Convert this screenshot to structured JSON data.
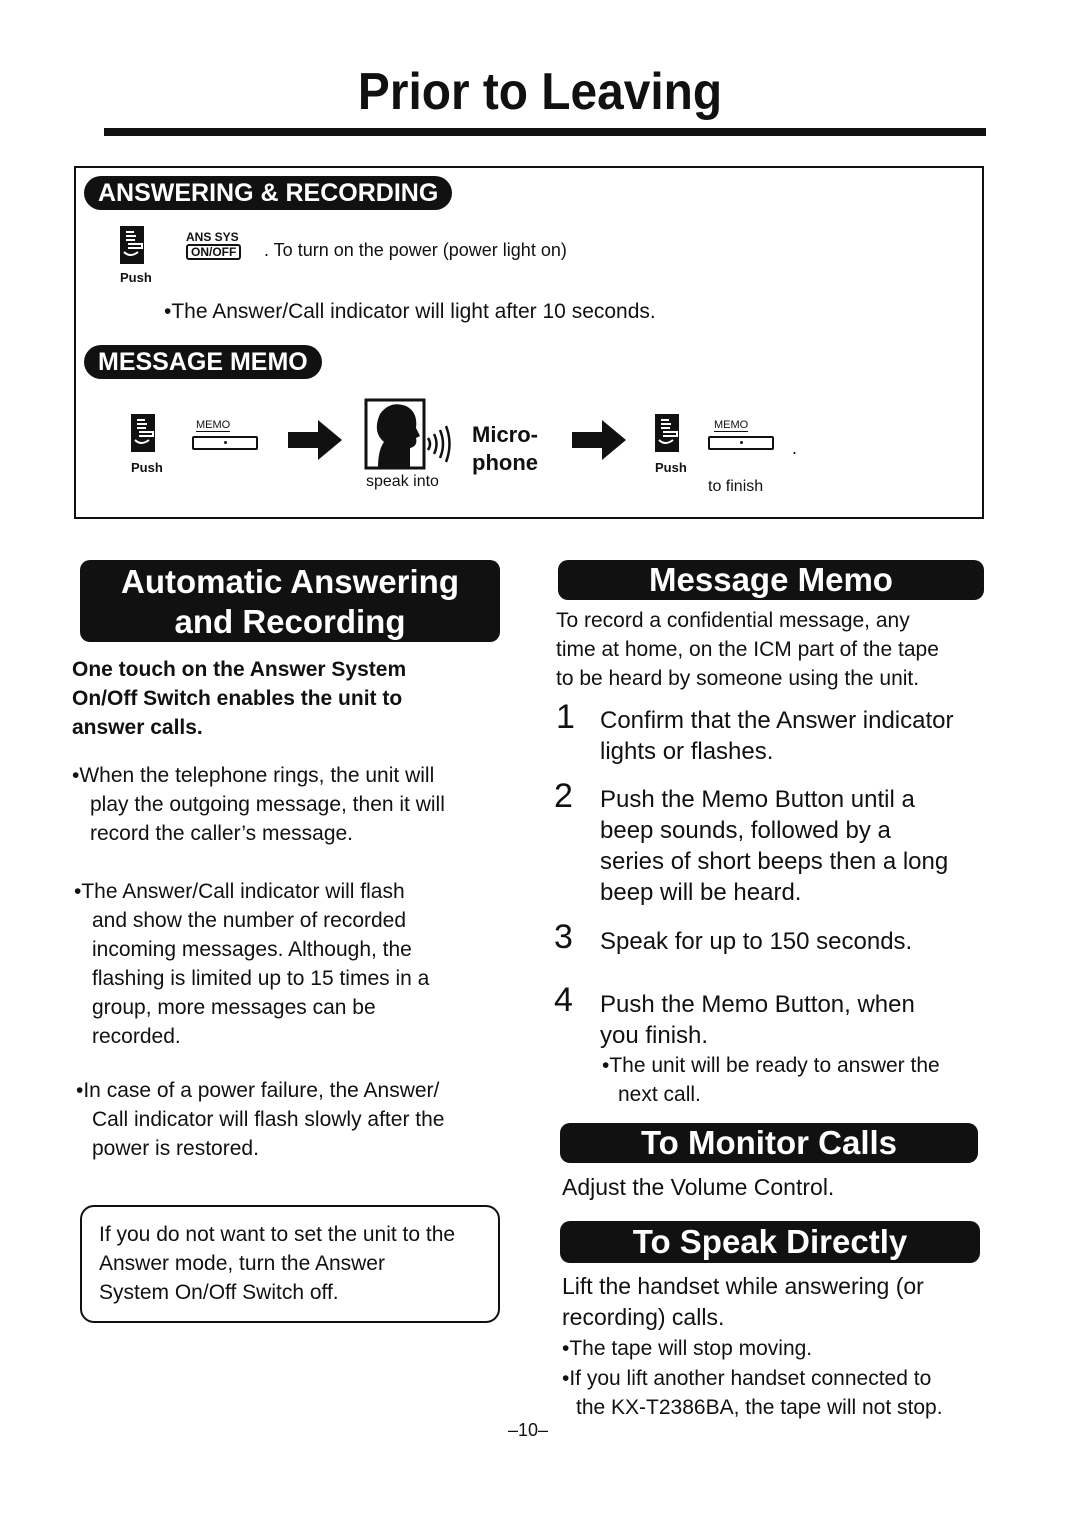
{
  "page": {
    "title": "Prior to Leaving",
    "page_number": "–10–"
  },
  "quick_guide": {
    "answering_recording": {
      "header": "ANSWERING & RECORDING",
      "push_label": "Push",
      "key_top": "ANS SYS",
      "key_label": "ON/OFF",
      "instruction": ". To turn on the power (power light on)",
      "note": "•The Answer/Call indicator will light after 10 seconds."
    },
    "message_memo": {
      "header": "MESSAGE MEMO",
      "step1_push": "Push",
      "step1_key": "MEMO",
      "step2_caption": "speak into",
      "step2_label_1": "Micro-",
      "step2_label_2": "phone",
      "step3_push": "Push",
      "step3_key": "MEMO",
      "step3_caption": "to finish",
      "step3_period": "."
    }
  },
  "auto_answer": {
    "header_line1": "Automatic Answering",
    "header_line2": "and Recording",
    "lead": [
      "One touch on the Answer System",
      "On/Off Switch enables the unit to",
      "answer calls."
    ],
    "bullets": [
      [
        "•When the telephone rings, the unit will",
        "play the outgoing message, then it will",
        "record the caller’s message."
      ],
      [
        "•The Answer/Call indicator will flash",
        "and show the number of recorded",
        "incoming messages. Although, the",
        "flashing is limited up to 15 times in a",
        "group, more messages can be",
        "recorded."
      ],
      [
        "•In case of a power failure, the Answer/",
        "Call indicator will flash slowly after the",
        "power is restored."
      ]
    ],
    "note": [
      "If you do not want to set the unit to the",
      "Answer  mode, turn the Answer",
      "System On/Off Switch off."
    ]
  },
  "message_memo": {
    "header": "Message Memo",
    "intro": [
      "To record a confidential message, any",
      "time at home, on the ICM part of the tape",
      "to be heard by someone using the unit."
    ],
    "steps": [
      {
        "num": "1",
        "lines": [
          "Confirm that the Answer indicator",
          "lights or flashes."
        ]
      },
      {
        "num": "2",
        "lines": [
          "Push the Memo Button until a",
          "beep sounds, followed by a",
          "series of short beeps then a long",
          "beep will be heard."
        ]
      },
      {
        "num": "3",
        "lines": [
          "Speak for up to 150 seconds."
        ]
      },
      {
        "num": "4",
        "lines": [
          "Push the Memo Button, when",
          "you finish."
        ]
      }
    ],
    "step4_note": [
      "•The unit will be ready to answer the",
      "next call."
    ]
  },
  "monitor": {
    "header": "To Monitor Calls",
    "text": "Adjust the Volume Control."
  },
  "speak_directly": {
    "header": "To Speak Directly",
    "text": [
      "Lift the handset while answering (or",
      "recording) calls."
    ],
    "bullets": [
      [
        "•The tape will stop moving."
      ],
      [
        "•If you lift another handset connected to",
        "the KX-T2386BA, the tape will not stop."
      ]
    ]
  }
}
